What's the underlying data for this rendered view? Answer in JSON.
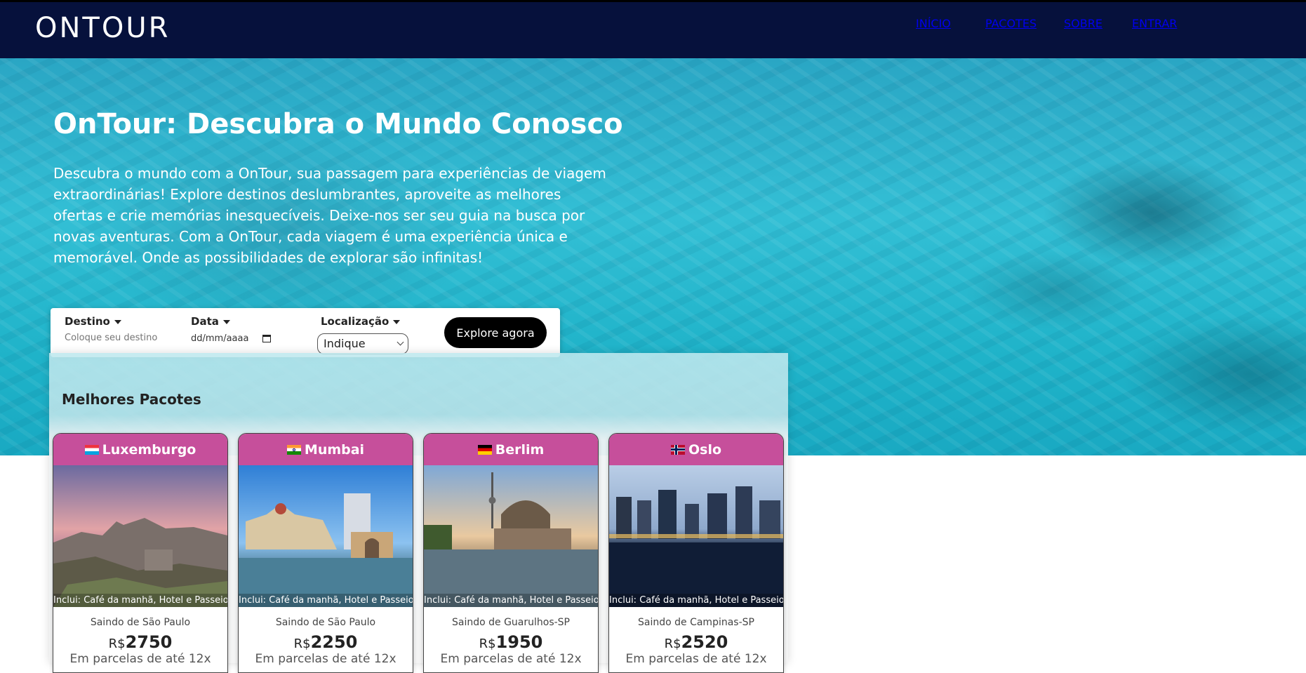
{
  "brand": {
    "logo": "ONTOUR"
  },
  "nav": {
    "items": [
      "INÍCIO",
      "PACOTES",
      "SOBRE",
      "ENTRAR"
    ]
  },
  "hero": {
    "title": "OnTour: Descubra o Mundo Conosco",
    "text": "Descubra o mundo com a OnTour, sua passagem para experiências de viagem extraordinárias! Explore destinos deslumbrantes, aproveite as melhores ofertas e crie memórias inesquecíveis. Deixe-nos ser seu guia na busca por novas aventuras. Com a OnTour, cada viagem é uma experiência única e memorável. Onde as possibilidades de explorar são infinitas!"
  },
  "search": {
    "destino_label": "Destino",
    "destino_placeholder": "Coloque seu destino",
    "data_label": "Data",
    "data_value": "dd/mm/aaaa",
    "localizacao_label": "Localização",
    "localizacao_selected": "Indique",
    "button_label": "Explore agora"
  },
  "packages": {
    "title": "Melhores Pacotes",
    "cards": [
      {
        "city": "Luxemburgo",
        "flag": "luxembourg-flag",
        "includes": "Inclui: Café da manhã, Hotel e Passeios",
        "from": "Saindo de São Paulo",
        "currency": "R$",
        "price": "2750",
        "installments": "Em parcelas de até 12x"
      },
      {
        "city": "Mumbai",
        "flag": "india-flag",
        "includes": "Inclui: Café da manhã, Hotel e Passeios",
        "from": "Saindo de São Paulo",
        "currency": "R$",
        "price": "2250",
        "installments": "Em parcelas de até 12x"
      },
      {
        "city": "Berlim",
        "flag": "germany-flag",
        "includes": "Inclui: Café da manhã, Hotel e Passeios",
        "from": "Saindo de Guarulhos-SP",
        "currency": "R$",
        "price": "1950",
        "installments": "Em parcelas de até 12x"
      },
      {
        "city": "Oslo",
        "flag": "norway-flag",
        "includes": "Inclui: Café da manhã, Hotel e Passeios",
        "from": "Saindo de Campinas-SP",
        "currency": "R$",
        "price": "2520",
        "installments": "Em parcelas de até 12x"
      }
    ]
  },
  "colors": {
    "navbar": "#06113c",
    "card_header": "#c64f9b",
    "button": "#000000"
  }
}
